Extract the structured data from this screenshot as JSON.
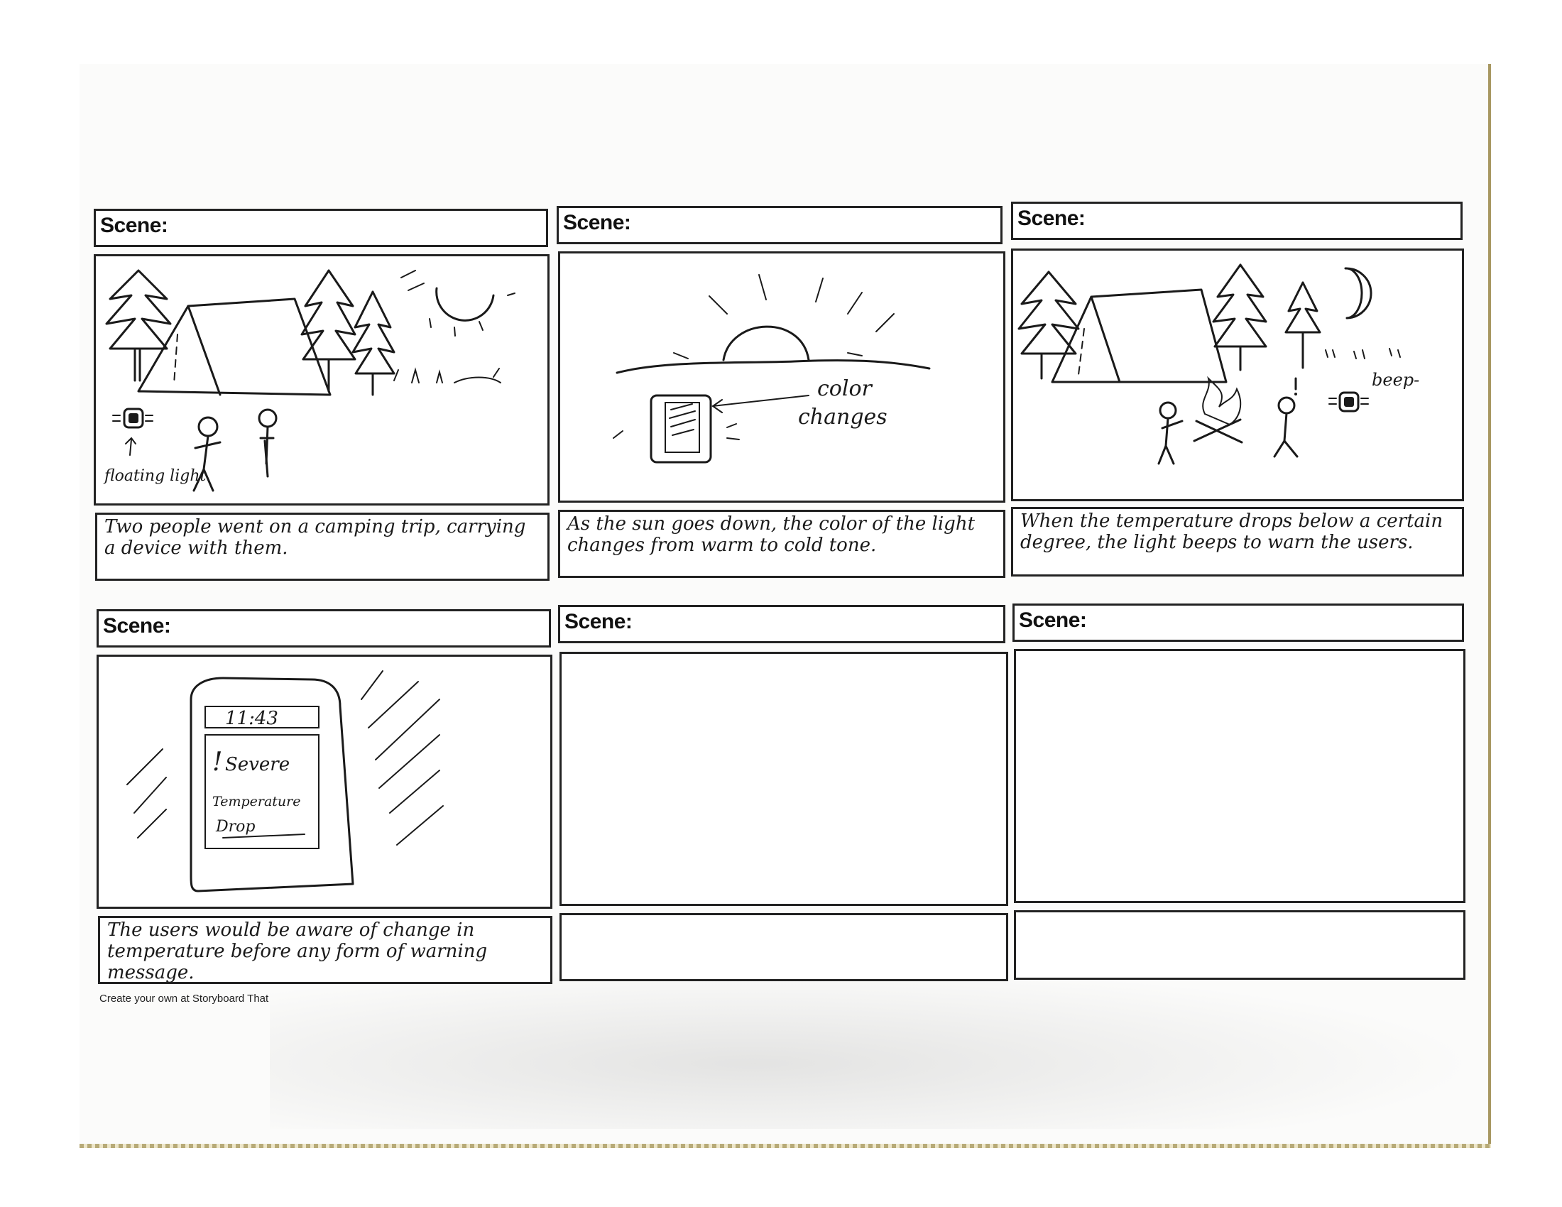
{
  "storyboard": {
    "scene_label": "Scene:",
    "footer": "Create your own at Storyboard That",
    "panels": [
      {
        "caption": "Two people went on a camping trip, carrying a device with them.",
        "annotations": {
          "floating_light": "floating light"
        }
      },
      {
        "caption": "As the sun goes down, the color of the light changes from warm to cold tone.",
        "annotations": {
          "color_changes_1": "color",
          "color_changes_2": "changes"
        }
      },
      {
        "caption": "When the temperature drops below a certain degree, the light beeps to warn the users.",
        "annotations": {
          "beep": "beep-"
        }
      },
      {
        "caption": "The users would be aware of change in temperature before any form of warning message.",
        "phone": {
          "time": "11:43",
          "alert_mark": "!",
          "alert_line1": "Severe",
          "alert_line2": "Temperature",
          "alert_line3": "Drop"
        }
      },
      {
        "caption": ""
      },
      {
        "caption": ""
      }
    ]
  }
}
